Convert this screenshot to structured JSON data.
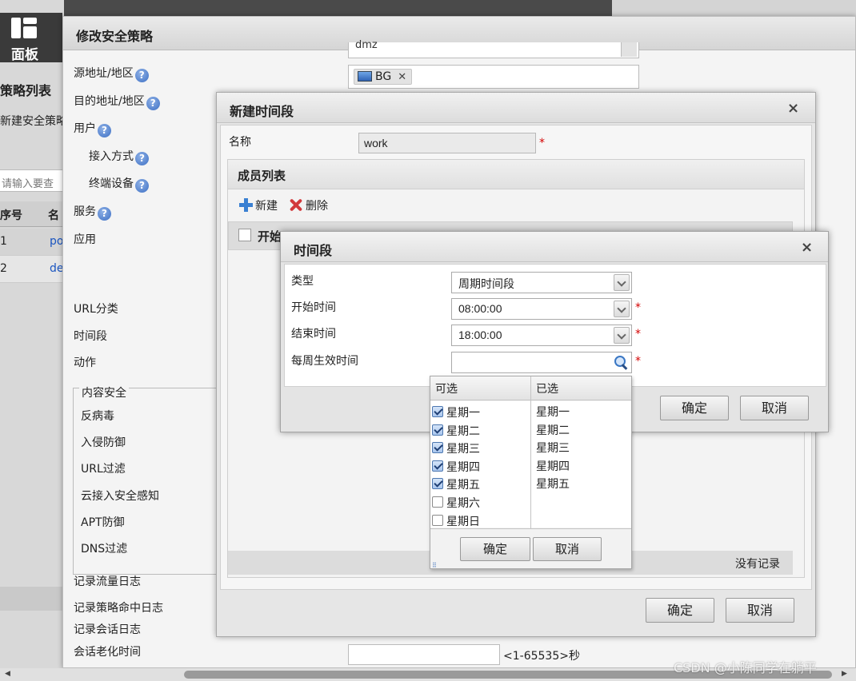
{
  "background": {
    "dashboard_label": "面板",
    "policy_list_title": "策略列表",
    "new_policy_link": "新建安全策略",
    "search_placeholder": "请输入要查",
    "table_headers": [
      "序号",
      "名"
    ],
    "rows": [
      {
        "index": "1",
        "name": "po"
      },
      {
        "index": "2",
        "name": "de"
      }
    ]
  },
  "modify_policy": {
    "title": "修改安全策略",
    "fields": {
      "source": "源地址/地区",
      "destination": "目的地址/地区",
      "user": "用户",
      "access_method": "接入方式",
      "terminal_device": "终端设备",
      "service": "服务",
      "application": "应用",
      "url_category": "URL分类",
      "time_range": "时间段",
      "action": "动作"
    },
    "help_glyph": "?",
    "source_value": "dmz",
    "destination_tag": "BG",
    "destination_tag_remove": "✕",
    "content_security": {
      "legend": "内容安全",
      "items": [
        "反病毒",
        "入侵防御",
        "URL过滤",
        "云接入安全感知",
        "APT防御",
        "DNS过滤"
      ]
    },
    "log_options": [
      "记录流量日志",
      "记录策略命中日志",
      "记录会话日志"
    ],
    "session_timeout_label": "会话老化时间",
    "session_timeout_value": "",
    "session_timeout_range": "<1-65535>秒"
  },
  "new_time_range": {
    "title": "新建时间段",
    "close_glyph": "×",
    "name_label": "名称",
    "name_value": "work",
    "required_mark": "*",
    "members_title": "成员列表",
    "toolbar": {
      "new_label": "新建",
      "delete_label": "删除"
    },
    "grid_first_column": "开始",
    "no_records": "没有记录",
    "ok_label": "确定",
    "cancel_label": "取消"
  },
  "time_period": {
    "title": "时间段",
    "close_glyph": "×",
    "type_label": "类型",
    "type_value": "周期时间段",
    "start_label": "开始时间",
    "start_value": "08:00:00",
    "end_label": "结束时间",
    "end_value": "18:00:00",
    "weekly_label": "每周生效时间",
    "weekly_value": "",
    "required_mark": "*",
    "ok_label": "确定",
    "cancel_label": "取消"
  },
  "weekday_dropdown": {
    "available_header": "可选",
    "selected_header": "已选",
    "days": [
      {
        "label": "星期一",
        "checked": true
      },
      {
        "label": "星期二",
        "checked": true
      },
      {
        "label": "星期三",
        "checked": true
      },
      {
        "label": "星期四",
        "checked": true
      },
      {
        "label": "星期五",
        "checked": true
      },
      {
        "label": "星期六",
        "checked": false
      },
      {
        "label": "星期日",
        "checked": false
      }
    ],
    "selected": [
      "星期一",
      "星期二",
      "星期三",
      "星期四",
      "星期五"
    ],
    "ok_label": "确定",
    "cancel_label": "取消"
  },
  "watermark": "CSDN @小陈同学在躺平"
}
